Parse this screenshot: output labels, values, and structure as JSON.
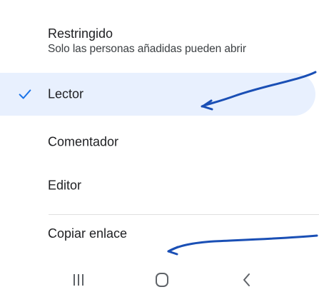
{
  "header": {
    "title": "Restringido",
    "subtitle": "Solo las personas añadidas pueden abrir"
  },
  "options": [
    {
      "label": "Lector",
      "selected": true
    },
    {
      "label": "Comentador",
      "selected": false
    },
    {
      "label": "Editor",
      "selected": false
    }
  ],
  "copy_link": {
    "label": "Copiar enlace"
  },
  "navbar": {
    "buttons": [
      "recents",
      "home",
      "back"
    ]
  },
  "colors": {
    "selected_bg": "#e8f0fe",
    "check": "#1a73e8",
    "annotation": "#1a4fb5",
    "nav_icon": "#5f6368"
  }
}
